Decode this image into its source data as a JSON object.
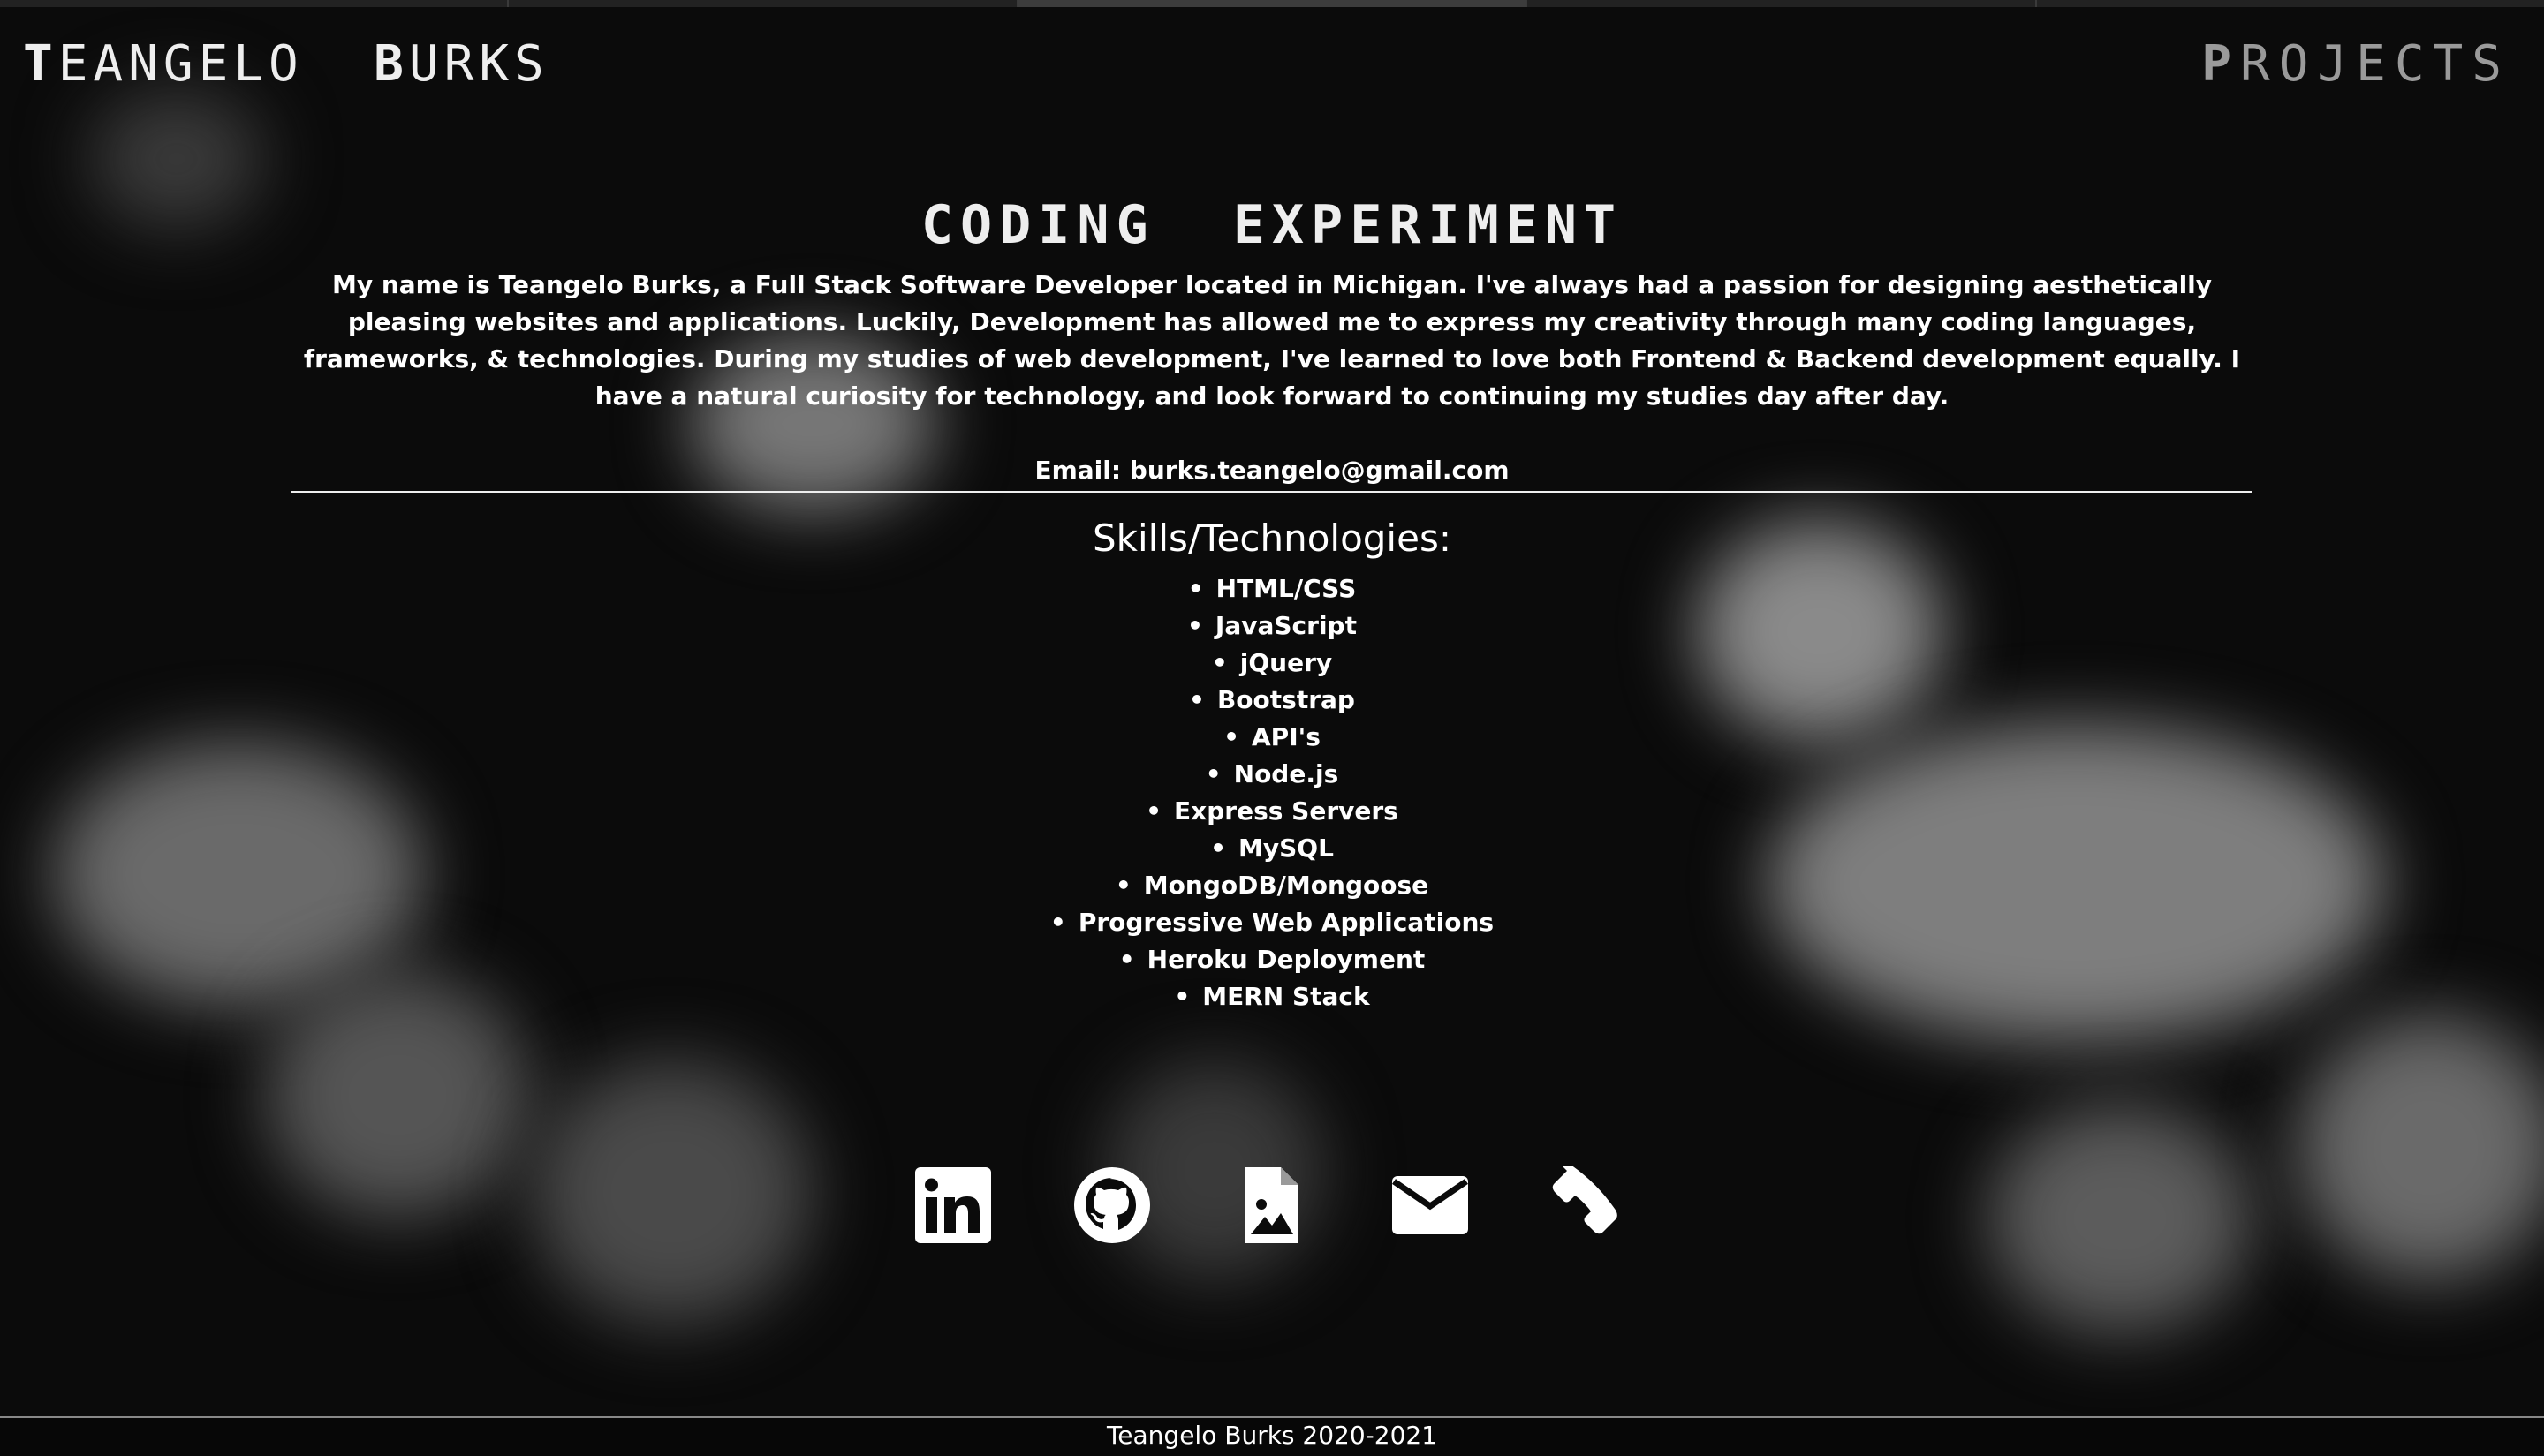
{
  "brand": {
    "first_initial": "T",
    "first_rest": "EANGELO",
    "last_initial": "B",
    "last_rest": "URKS"
  },
  "nav": {
    "projects_initial": "P",
    "projects_rest": "ROJECTS"
  },
  "heading": {
    "w1_initial": "C",
    "w1_rest": "ODING",
    "w2_initial": "E",
    "w2_rest": "XPERIMENT"
  },
  "bio": "My name is Teangelo Burks, a Full Stack Software Developer located in Michigan. I've always had a passion for designing aesthetically pleasing websites and applications. Luckily, Development has allowed me to express my creativity through many coding languages, frameworks, & technologies. During my studies of web development, I've learned to love both Frontend & Backend development equally. I have a natural curiosity for technology, and look forward to continuing my studies day after day.",
  "email": "Email: burks.teangelo@gmail.com",
  "skills_title": "Skills/Technologies:",
  "skills": [
    "HTML/CSS",
    "JavaScript",
    "jQuery",
    "Bootstrap",
    "API's",
    "Node.js",
    "Express Servers",
    "MySQL",
    "MongoDB/Mongoose",
    "Progressive Web Applications",
    "Heroku Deployment",
    "MERN Stack"
  ],
  "social_icons": [
    "linkedin-icon",
    "github-icon",
    "resume-file-icon",
    "email-icon",
    "phone-icon"
  ],
  "footer": "Teangelo Burks 2020-2021",
  "colors": {
    "background": "#0b0b0b",
    "text": "#ffffff",
    "muted": "#9a9a9a"
  }
}
